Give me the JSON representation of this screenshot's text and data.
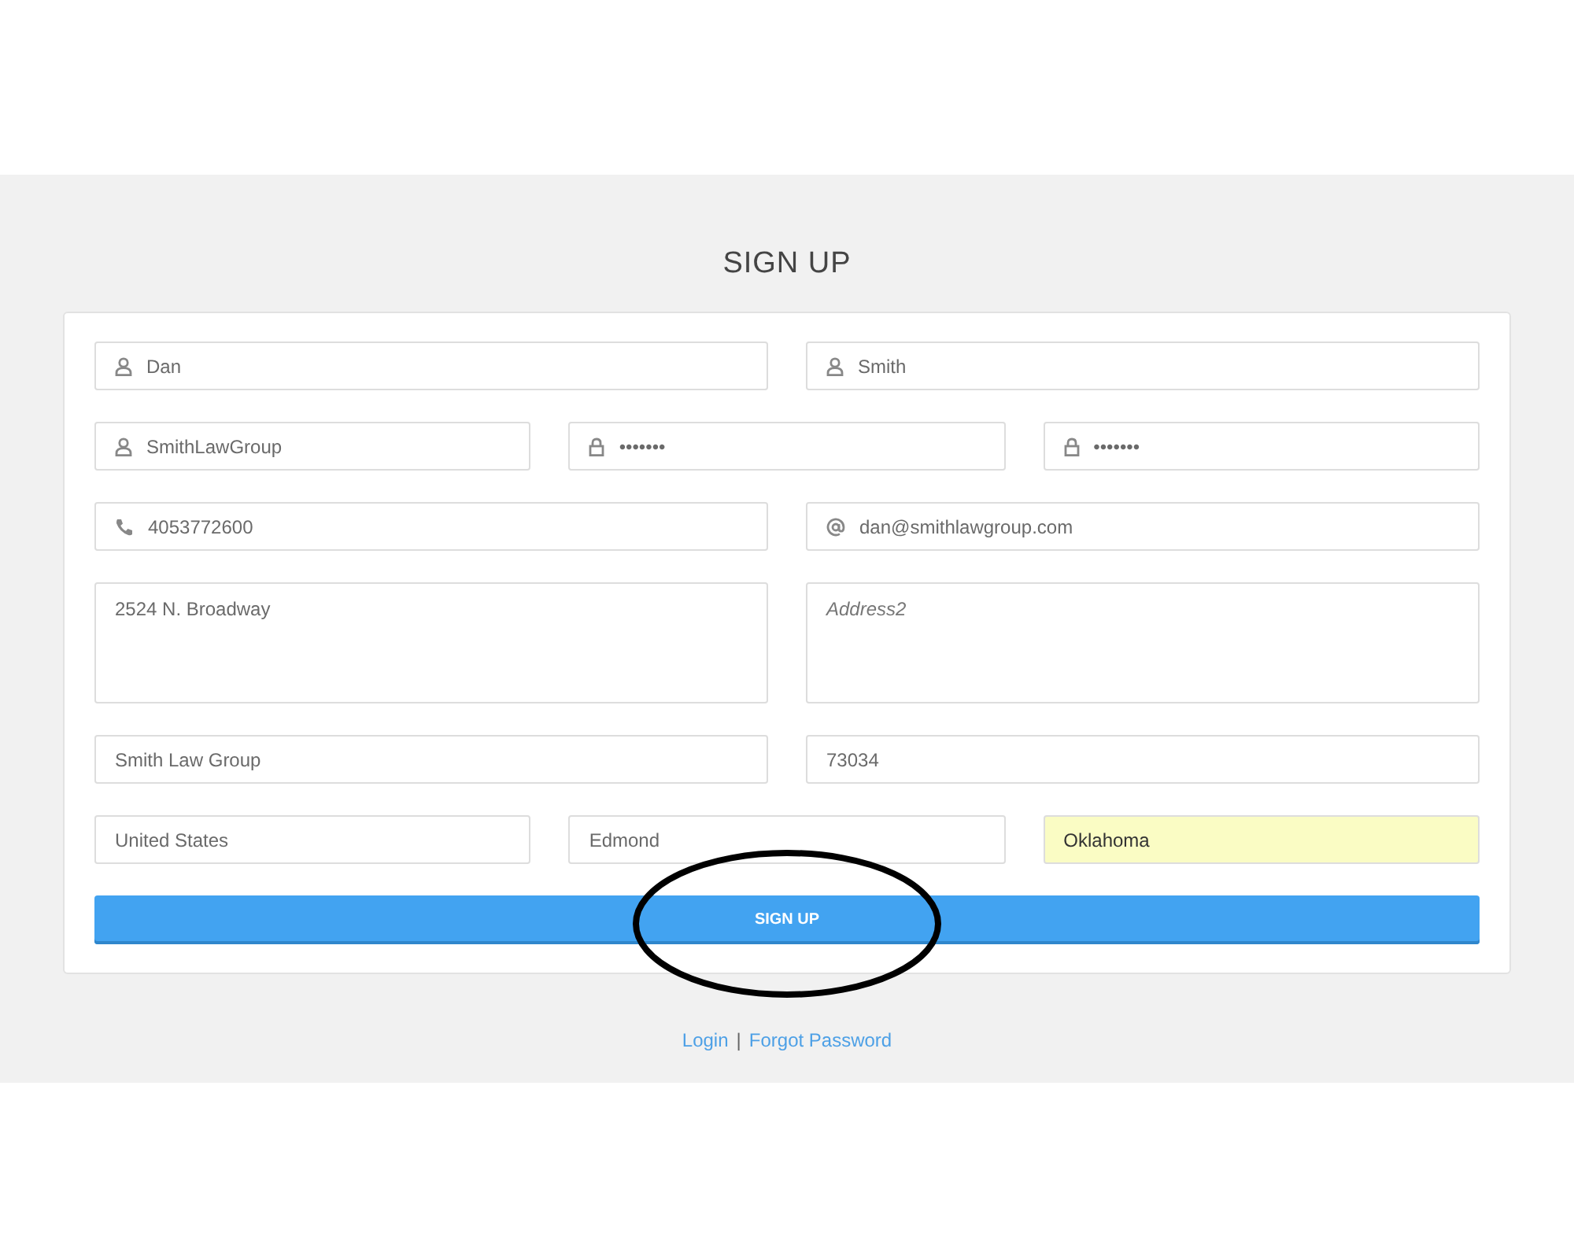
{
  "title": "SIGN UP",
  "rows": [
    {
      "fields": [
        {
          "kind": "name",
          "value": "Dan",
          "autofilled": false
        },
        {
          "kind": "name",
          "value": "Smith",
          "autofilled": false
        }
      ]
    },
    {
      "fields": [
        {
          "kind": "name",
          "value": "SmithLawGroup",
          "autofilled": false
        },
        {
          "kind": "password",
          "value": "•••••••",
          "autofilled": false
        },
        {
          "kind": "password",
          "value": "•••••••",
          "autofilled": false
        }
      ]
    },
    {
      "fields": [
        {
          "kind": "phone",
          "value": "4053772600",
          "autofilled": false
        },
        {
          "kind": "email",
          "value": "dan@smithlawgroup.com",
          "autofilled": false
        }
      ]
    },
    {
      "fields": [
        {
          "kind": "textarea",
          "value": "2524 N. Broadway",
          "autofilled": false
        },
        {
          "kind": "textarea",
          "placeholder": "Address2",
          "autofilled": false
        }
      ]
    },
    {
      "fields": [
        {
          "kind": "text",
          "value": "Smith Law Group",
          "autofilled": false
        },
        {
          "kind": "text",
          "value": "73034",
          "autofilled": false
        }
      ]
    },
    {
      "fields": [
        {
          "kind": "text",
          "value": "United States",
          "autofilled": false
        },
        {
          "kind": "text",
          "value": "Edmond",
          "autofilled": false
        },
        {
          "kind": "text",
          "value": "Oklahoma",
          "autofilled": true
        }
      ]
    }
  ],
  "submit_button": "SIGN UP",
  "footer_links": [
    {
      "label": "Login"
    },
    {
      "label": "Forgot Password"
    }
  ],
  "footer_separator": "|"
}
